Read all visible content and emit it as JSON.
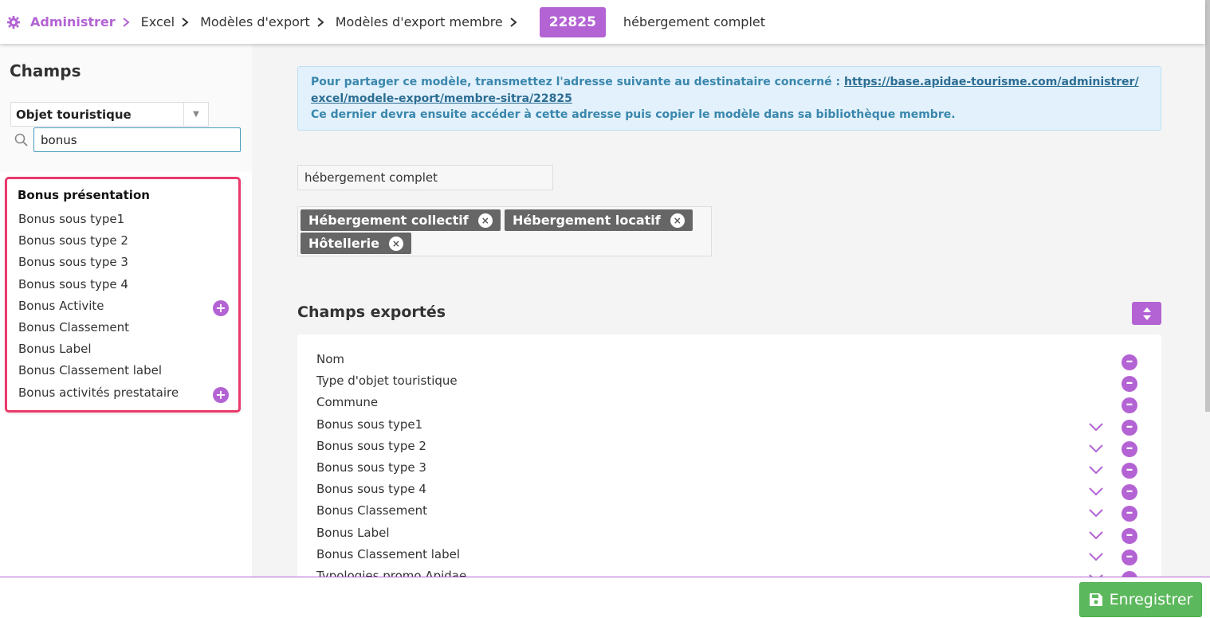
{
  "breadcrumb": {
    "items": [
      "Administrer",
      "Excel",
      "Modèles d'export",
      "Modèles d'export membre"
    ],
    "id_badge": "22825",
    "current": "hébergement complet"
  },
  "sidebar": {
    "title": "Champs",
    "select_value": "Objet touristique",
    "search_value": "bonus",
    "results_title": "Bonus présentation",
    "results": [
      {
        "label": "Bonus sous type1",
        "has_plus": false
      },
      {
        "label": "Bonus sous type 2",
        "has_plus": false
      },
      {
        "label": "Bonus sous type 3",
        "has_plus": false
      },
      {
        "label": "Bonus sous type 4",
        "has_plus": false
      },
      {
        "label": "Bonus Activite",
        "has_plus": true
      },
      {
        "label": "Bonus Classement",
        "has_plus": false
      },
      {
        "label": "Bonus Label",
        "has_plus": false
      },
      {
        "label": "Bonus Classement label",
        "has_plus": false
      },
      {
        "label": "Bonus activités prestataire",
        "has_plus": true
      }
    ]
  },
  "info": {
    "text1": "Pour partager ce modèle, transmettez l'adresse suivante au destinataire concerné : ",
    "link_line1": "https://base.apidae-tourisme.com/administrer/",
    "link_line2": "excel/modele-export/membre-sitra/22825",
    "text2": "Ce dernier devra ensuite accéder à cette adresse puis copier le modèle dans sa bibliothèque membre."
  },
  "model": {
    "name": "hébergement complet",
    "tags": [
      "Hébergement collectif",
      "Hébergement locatif",
      "Hôtellerie"
    ]
  },
  "exported": {
    "title": "Champs exportés",
    "rows": [
      {
        "label": "Nom",
        "has_down": false
      },
      {
        "label": "Type d'objet touristique",
        "has_down": false
      },
      {
        "label": "Commune",
        "has_down": false
      },
      {
        "label": "Bonus sous type1",
        "has_down": true
      },
      {
        "label": "Bonus sous type 2",
        "has_down": true
      },
      {
        "label": "Bonus sous type 3",
        "has_down": true
      },
      {
        "label": "Bonus sous type 4",
        "has_down": true
      },
      {
        "label": "Bonus Classement",
        "has_down": true
      },
      {
        "label": "Bonus Label",
        "has_down": true
      },
      {
        "label": "Bonus Classement label",
        "has_down": true
      },
      {
        "label": "Typologies promo Apidae",
        "has_down": true
      }
    ]
  },
  "footer": {
    "save_label": "Enregistrer"
  },
  "colors": {
    "accent": "#b363d3",
    "highlight_border": "#ea3a6c",
    "save": "#5cb85c",
    "info_text": "#3a87ad"
  },
  "icons": {
    "admin": "gear-icon",
    "search": "search-icon",
    "sort": "sort-icon",
    "save": "floppy-disk-icon"
  }
}
